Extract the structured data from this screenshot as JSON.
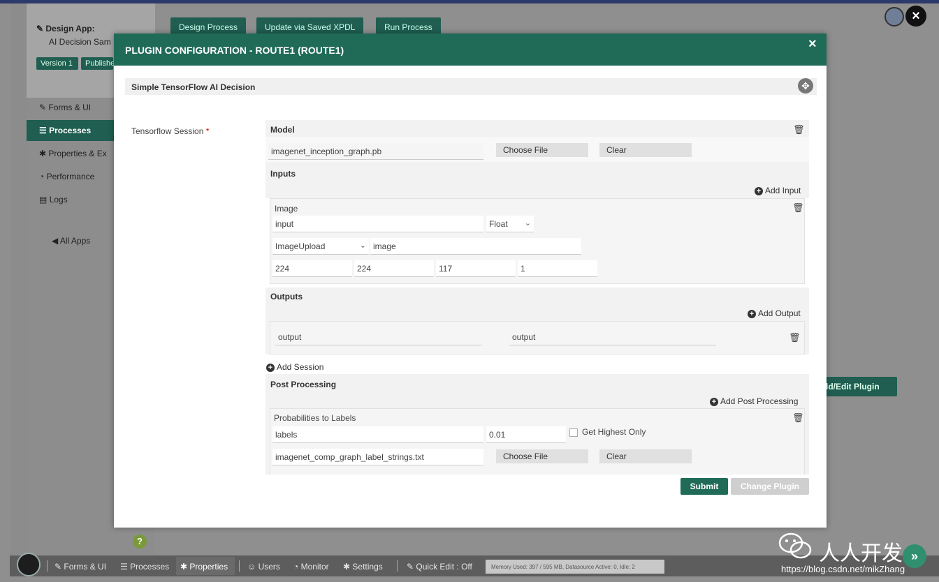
{
  "app": {
    "title": "Design App:",
    "subtitle": "AI Decision Sam",
    "version_label": "Version 1",
    "published_label": "Publishe",
    "tabs": [
      "Design Process",
      "Update via Saved XPDL",
      "Run Process"
    ],
    "sidebar": [
      {
        "label": "Forms & UI",
        "icon": "edit-icon"
      },
      {
        "label": "Processes",
        "icon": "list-icon",
        "active": true
      },
      {
        "label": "Properties & Ex",
        "icon": "gear-icon"
      },
      {
        "label": "Performance",
        "icon": "dashboard-icon"
      },
      {
        "label": "Logs",
        "icon": "logs-icon"
      }
    ],
    "all_apps": "All Apps",
    "edit_plugin_button": "dd/Edit Plugin",
    "help_icon": "?",
    "close_icon": "×"
  },
  "bottom_bar": {
    "items": [
      "Forms & UI",
      "Processes",
      "Properties",
      "Users",
      "Monitor",
      "Settings",
      "Quick Edit : Off"
    ],
    "memory": "Memory Used: 397 / 595 MB, Datasource Active: 0, Idle: 2"
  },
  "watermark": {
    "text": "人人开发",
    "url": "https://blog.csdn.net/mikZhang"
  },
  "modal": {
    "title": "PLUGIN CONFIGURATION - ROUTE1 (ROUTE1)",
    "close": "×",
    "plugin_name": "Simple TensorFlow AI Decision",
    "session_label": "Tensorflow Session",
    "required_mark": "*",
    "model": {
      "title": "Model",
      "value": "imagenet_inception_graph.pb",
      "choose_file": "Choose File",
      "clear": "Clear"
    },
    "inputs": {
      "title": "Inputs",
      "add": "Add Input",
      "item": {
        "title": "Image",
        "name": "input",
        "type": "Float",
        "source": "ImageUpload",
        "source_name": "image",
        "dims": [
          "224",
          "224",
          "117",
          "1"
        ]
      }
    },
    "outputs": {
      "title": "Outputs",
      "add": "Add Output",
      "item": {
        "name": "output",
        "variable": "output"
      }
    },
    "add_session": "Add Session",
    "post_processing": {
      "title": "Post Processing",
      "add": "Add Post Processing",
      "item": {
        "title": "Probabilities to Labels",
        "variable": "labels",
        "threshold": "0.01",
        "highest_only_label": "Get Highest Only",
        "highest_only": false,
        "labels_file": "imagenet_comp_graph_label_strings.txt",
        "choose_file": "Choose File",
        "clear": "Clear"
      }
    },
    "submit": "Submit",
    "change_plugin": "Change Plugin"
  },
  "colors": {
    "accent": "#1f6b58",
    "dim_background": "#8f8f8f"
  }
}
